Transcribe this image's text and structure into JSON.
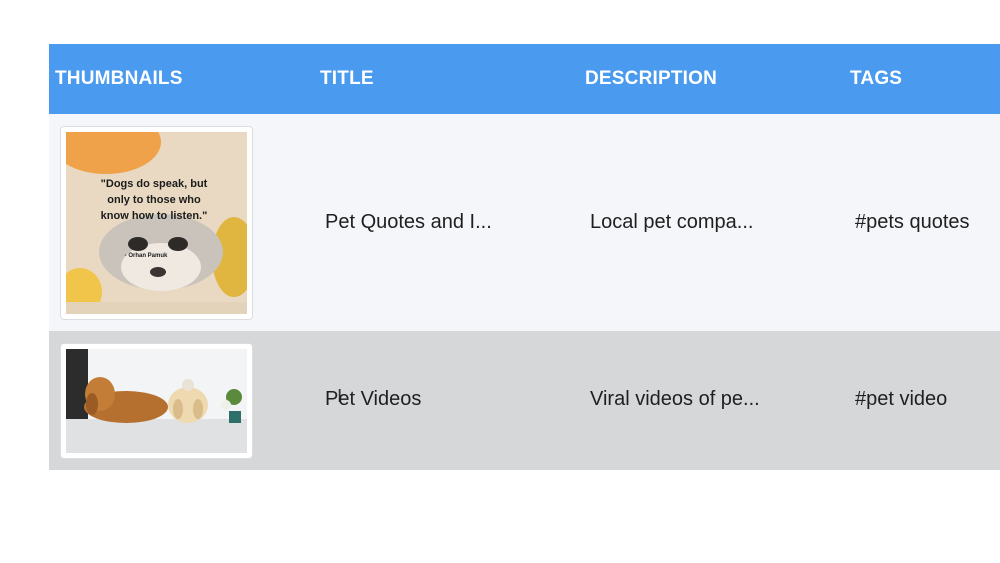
{
  "table": {
    "headers": [
      "THUMBNAILS",
      "TITLE",
      "DESCRIPTION",
      "TAGS"
    ],
    "rows": [
      {
        "thumbnail": "dog-quote-image",
        "quote_text": "\"Dogs do speak, but only to those who know how to listen.\"",
        "quote_author": "- Orhan Pamuk",
        "title": "Pet Quotes and I...",
        "description": "Local pet compa...",
        "tags": "#pets quotes"
      },
      {
        "thumbnail": "dog-video-image",
        "title": "Pet Videos",
        "description": "Viral videos of pe...",
        "tags": "#pet video"
      }
    ]
  },
  "colors": {
    "header_bg": "#4a9bef",
    "row_even_bg": "#f5f6fa",
    "row_selected_bg": "#d6d7d9"
  },
  "cursor_icon": "text-cursor-icon"
}
